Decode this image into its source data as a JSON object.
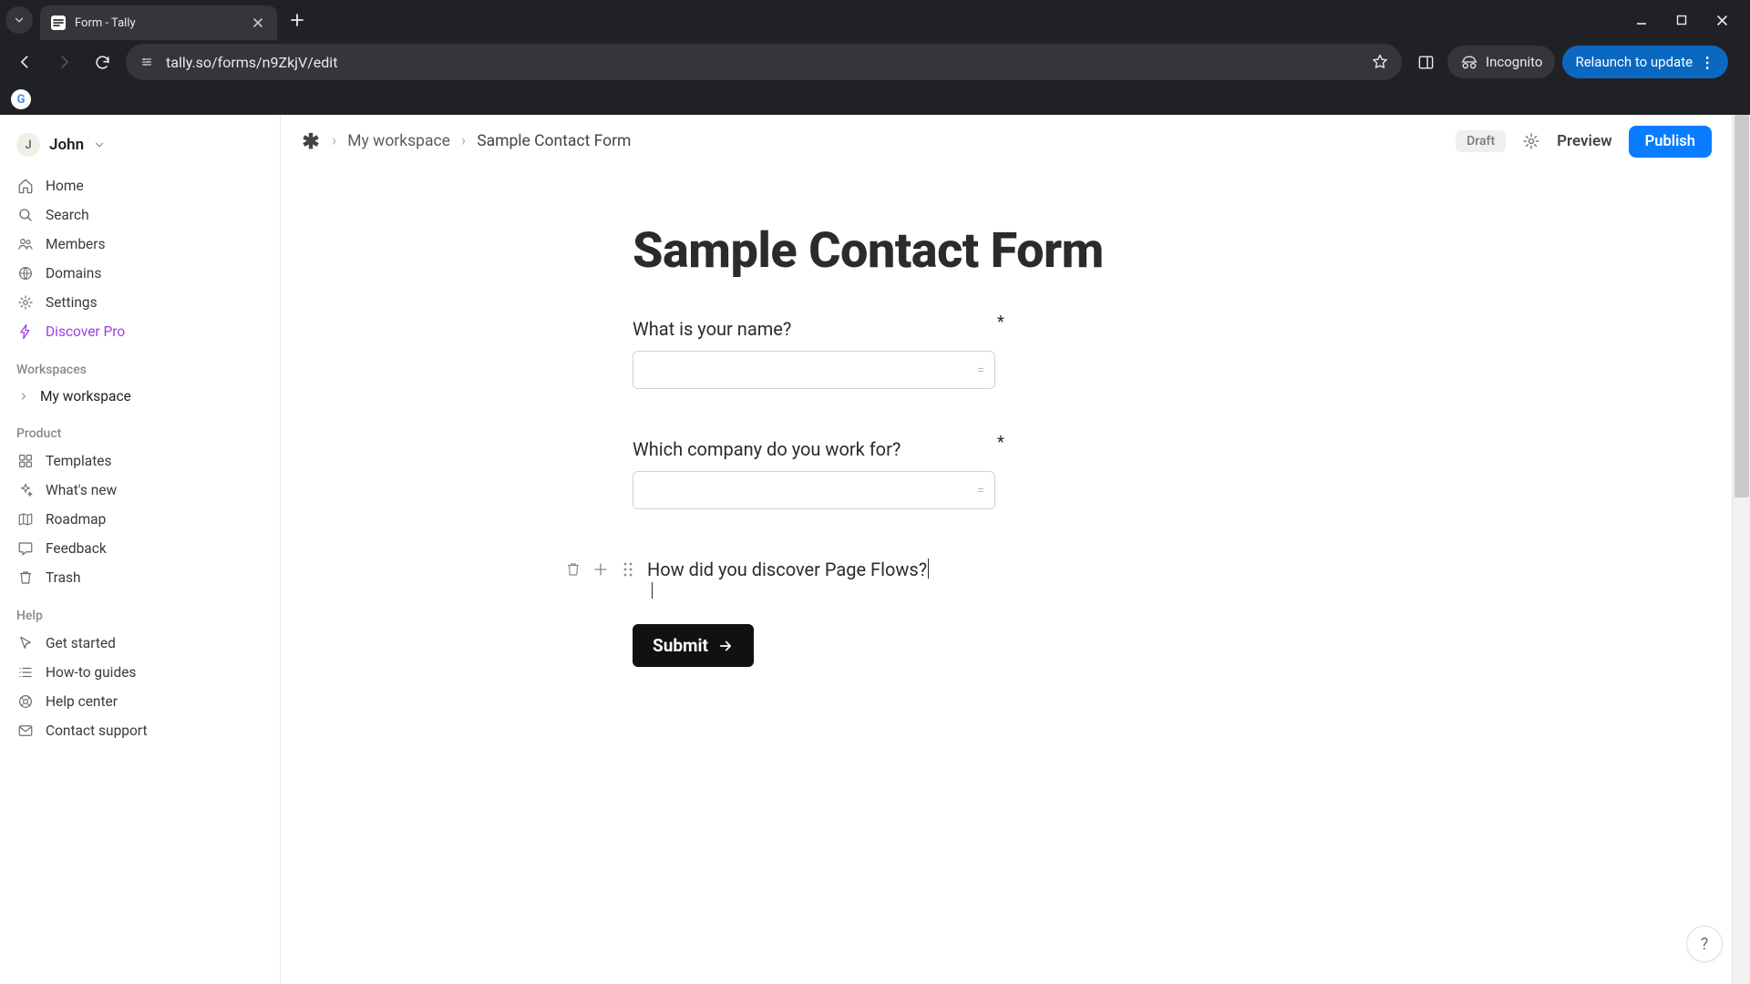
{
  "browser": {
    "tab_title": "Form - Tally",
    "url": "tally.so/forms/n9ZkjV/edit",
    "incognito_label": "Incognito",
    "relaunch_label": "Relaunch to update"
  },
  "sidebar": {
    "user_initial": "J",
    "user_name": "John",
    "nav": [
      {
        "icon": "home",
        "label": "Home"
      },
      {
        "icon": "search",
        "label": "Search"
      },
      {
        "icon": "members",
        "label": "Members"
      },
      {
        "icon": "globe",
        "label": "Domains"
      },
      {
        "icon": "gear",
        "label": "Settings"
      },
      {
        "icon": "bolt",
        "label": "Discover Pro",
        "pro": true
      }
    ],
    "sections": {
      "workspaces": {
        "label": "Workspaces",
        "items": [
          "My workspace"
        ]
      },
      "product": {
        "label": "Product",
        "items": [
          {
            "icon": "templates",
            "label": "Templates"
          },
          {
            "icon": "sparkle",
            "label": "What's new"
          },
          {
            "icon": "map",
            "label": "Roadmap"
          },
          {
            "icon": "chat",
            "label": "Feedback"
          },
          {
            "icon": "trash",
            "label": "Trash"
          }
        ]
      },
      "help": {
        "label": "Help",
        "items": [
          {
            "icon": "cursor",
            "label": "Get started"
          },
          {
            "icon": "list",
            "label": "How-to guides"
          },
          {
            "icon": "life",
            "label": "Help center"
          },
          {
            "icon": "mail",
            "label": "Contact support"
          }
        ]
      }
    }
  },
  "topbar": {
    "crumb_workspace": "My workspace",
    "crumb_form": "Sample Contact Form",
    "draft_label": "Draft",
    "preview_label": "Preview",
    "publish_label": "Publish"
  },
  "form": {
    "title": "Sample Contact Form",
    "q1_label": "What is your name?",
    "q2_label": "Which company do you work for?",
    "q3_label": "How did you discover Page Flows?",
    "submit_label": "Submit"
  },
  "help_fab": "?"
}
